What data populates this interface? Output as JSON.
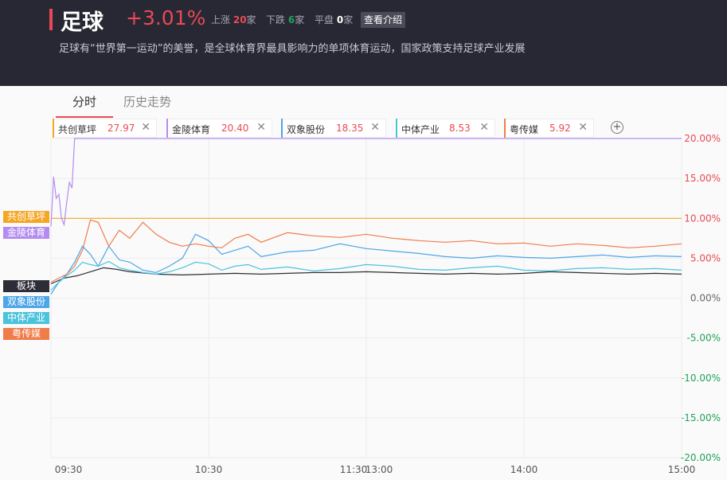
{
  "header": {
    "title": "足球",
    "change": "+3.01%",
    "up_label": "上涨",
    "up_count": "20",
    "up_unit": "家",
    "down_label": "下跌",
    "down_count": "6",
    "down_unit": "家",
    "flat_label": "平盘",
    "flat_count": "0",
    "flat_unit": "家",
    "intro_button": "查看介绍",
    "description": "足球有“世界第一运动”的美誉，是全球体育界最具影响力的单项体育运动，国家政策支持足球产业发展"
  },
  "tabs": [
    {
      "label": "分时",
      "active": true
    },
    {
      "label": "历史走势",
      "active": false
    }
  ],
  "legend": [
    {
      "name": "共创草坪",
      "value": "27.97",
      "color": "#f5a623"
    },
    {
      "name": "金陵体育",
      "value": "20.40",
      "color": "#b48cf0"
    },
    {
      "name": "双象股份",
      "value": "18.35",
      "color": "#4da6e8"
    },
    {
      "name": "中体产业",
      "value": "8.53",
      "color": "#4cc3dd"
    },
    {
      "name": "粤传媒",
      "value": "5.92",
      "color": "#f07c4a"
    }
  ],
  "add_icon": "plus-circle-icon",
  "close_icon": "close-x-icon",
  "series_tags": [
    {
      "label": "共创草坪",
      "color": "#f5a623"
    },
    {
      "label": "金陵体育",
      "color": "#b48cf0"
    },
    {
      "label": "板块",
      "color": "#2d2d38"
    },
    {
      "label": "双象股份",
      "color": "#4da6e8"
    },
    {
      "label": "中体产业",
      "color": "#4cc3dd"
    },
    {
      "label": "粤传媒",
      "color": "#f07c4a"
    }
  ],
  "chart_data": {
    "type": "line",
    "x_ticks": [
      "09:30",
      "10:30",
      "11:30",
      "13:00",
      "14:00",
      "15:00"
    ],
    "y_ticks": [
      "20.00%",
      "15.00%",
      "10.00%",
      "5.00%",
      "0.00%",
      "-5.00%",
      "-10.00%",
      "-15.00%",
      "-20.00%"
    ],
    "ylim": [
      -20,
      20
    ],
    "grid": true,
    "series": [
      {
        "name": "共创草坪",
        "color": "#f5a623",
        "x": [
          0,
          240
        ],
        "y": [
          10.0,
          10.0
        ]
      },
      {
        "name": "金陵体育",
        "color": "#b48cf0",
        "x": [
          0,
          1,
          2,
          3,
          4,
          5,
          6,
          7,
          8,
          9,
          240
        ],
        "y": [
          9.0,
          15.2,
          12.5,
          13.0,
          10.0,
          9.2,
          12.0,
          14.5,
          13.8,
          20.0,
          20.0
        ]
      },
      {
        "name": "板块",
        "color": "#2d2d38",
        "x": [
          0,
          5,
          10,
          15,
          20,
          25,
          30,
          40,
          50,
          60,
          70,
          80,
          90,
          100,
          110,
          120,
          130,
          140,
          150,
          160,
          170,
          180,
          190,
          200,
          210,
          220,
          230,
          240
        ],
        "y": [
          1.8,
          2.5,
          2.8,
          3.3,
          3.8,
          3.6,
          3.3,
          3.0,
          2.9,
          3.0,
          3.1,
          3.0,
          3.1,
          3.2,
          3.2,
          3.3,
          3.2,
          3.1,
          3.0,
          3.1,
          3.0,
          3.1,
          3.3,
          3.2,
          3.1,
          3.0,
          3.1,
          3.0
        ]
      },
      {
        "name": "双象股份",
        "color": "#4da6e8",
        "x": [
          0,
          3,
          6,
          9,
          12,
          15,
          18,
          22,
          26,
          30,
          35,
          40,
          45,
          50,
          55,
          60,
          65,
          70,
          75,
          80,
          90,
          100,
          110,
          120,
          130,
          140,
          150,
          160,
          170,
          180,
          190,
          200,
          210,
          220,
          230,
          240
        ],
        "y": [
          0.5,
          2.0,
          3.0,
          4.5,
          6.5,
          5.5,
          4.0,
          6.5,
          4.8,
          4.5,
          3.5,
          3.2,
          4.0,
          5.0,
          8.0,
          7.2,
          5.5,
          6.0,
          6.5,
          5.2,
          5.8,
          6.0,
          6.8,
          6.2,
          5.9,
          5.6,
          5.2,
          5.0,
          5.3,
          5.1,
          5.0,
          5.2,
          5.4,
          5.1,
          5.3,
          5.2
        ]
      },
      {
        "name": "中体产业",
        "color": "#4cc3dd",
        "x": [
          0,
          3,
          6,
          9,
          12,
          15,
          18,
          22,
          26,
          30,
          35,
          40,
          45,
          50,
          55,
          60,
          65,
          70,
          75,
          80,
          90,
          100,
          110,
          120,
          130,
          140,
          150,
          160,
          170,
          180,
          190,
          200,
          210,
          220,
          230,
          240
        ],
        "y": [
          1.0,
          2.0,
          2.8,
          3.5,
          4.5,
          4.2,
          4.0,
          4.6,
          3.8,
          3.5,
          3.2,
          3.0,
          3.3,
          3.8,
          4.5,
          4.3,
          3.5,
          4.0,
          4.2,
          3.6,
          3.9,
          3.4,
          3.7,
          4.2,
          4.0,
          3.6,
          3.5,
          3.8,
          4.0,
          3.5,
          3.4,
          3.7,
          3.8,
          3.6,
          3.7,
          3.5
        ]
      },
      {
        "name": "粤传媒",
        "color": "#f07c4a",
        "x": [
          0,
          3,
          6,
          9,
          12,
          15,
          18,
          22,
          26,
          30,
          35,
          40,
          45,
          50,
          55,
          60,
          65,
          70,
          75,
          80,
          90,
          100,
          110,
          120,
          130,
          140,
          150,
          160,
          170,
          180,
          190,
          200,
          210,
          220,
          230,
          240
        ],
        "y": [
          2.0,
          2.5,
          3.0,
          4.0,
          6.0,
          9.8,
          9.5,
          6.5,
          8.5,
          7.5,
          9.5,
          8.0,
          7.0,
          6.5,
          6.8,
          6.5,
          6.3,
          7.5,
          8.0,
          7.0,
          8.2,
          7.8,
          7.6,
          8.0,
          7.5,
          7.2,
          7.0,
          7.2,
          6.8,
          6.9,
          6.5,
          6.8,
          6.6,
          6.3,
          6.5,
          6.8
        ]
      }
    ]
  }
}
